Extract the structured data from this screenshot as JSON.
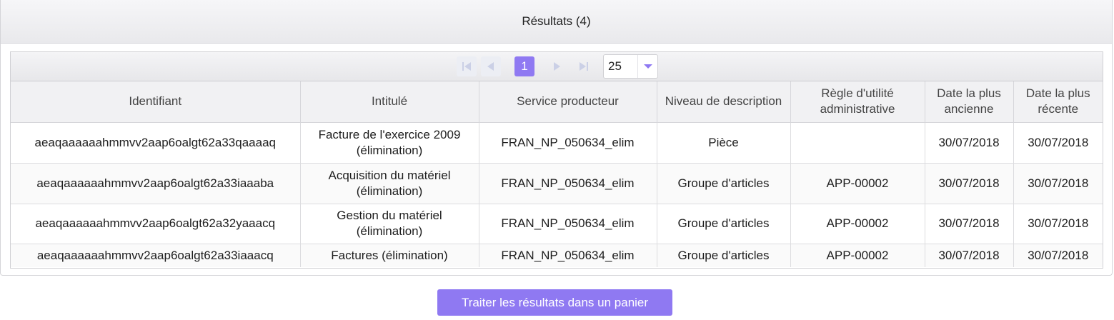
{
  "panel": {
    "title": "Résultats (4)"
  },
  "paginator": {
    "current_page": "1",
    "rows_per_page": "25",
    "first_icon": "first-page-icon",
    "prev_icon": "prev-page-icon",
    "next_icon": "next-page-icon",
    "last_icon": "last-page-icon"
  },
  "table": {
    "headers": [
      "Identifiant",
      "Intitulé",
      "Service producteur",
      "Niveau de description",
      "Règle d'utilité administrative",
      "Date la plus ancienne",
      "Date la plus récente"
    ],
    "rows": [
      [
        "aeaqaaaaaahmmvv2aap6oalgt62a33qaaaaq",
        "Facture de l'exercice 2009 (élimination)",
        "FRAN_NP_050634_elim",
        "Pièce",
        "",
        "30/07/2018",
        "30/07/2018"
      ],
      [
        "aeaqaaaaaahmmvv2aap6oalgt62a33iaaaba",
        "Acquisition du matériel (élimination)",
        "FRAN_NP_050634_elim",
        "Groupe d'articles",
        "APP-00002",
        "30/07/2018",
        "30/07/2018"
      ],
      [
        "aeaqaaaaaahmmvv2aap6oalgt62a32yaaacq",
        "Gestion du matériel (élimination)",
        "FRAN_NP_050634_elim",
        "Groupe d'articles",
        "APP-00002",
        "30/07/2018",
        "30/07/2018"
      ],
      [
        "aeaqaaaaaahmmvv2aap6oalgt62a33iaaacq",
        "Factures (élimination)",
        "FRAN_NP_050634_elim",
        "Groupe d'articles",
        "APP-00002",
        "30/07/2018",
        "30/07/2018"
      ]
    ]
  },
  "actions": {
    "process_label": "Traiter les résultats dans un panier"
  },
  "colors": {
    "accent": "#8f79f2",
    "disabled_nav": "#cbd0e6"
  }
}
